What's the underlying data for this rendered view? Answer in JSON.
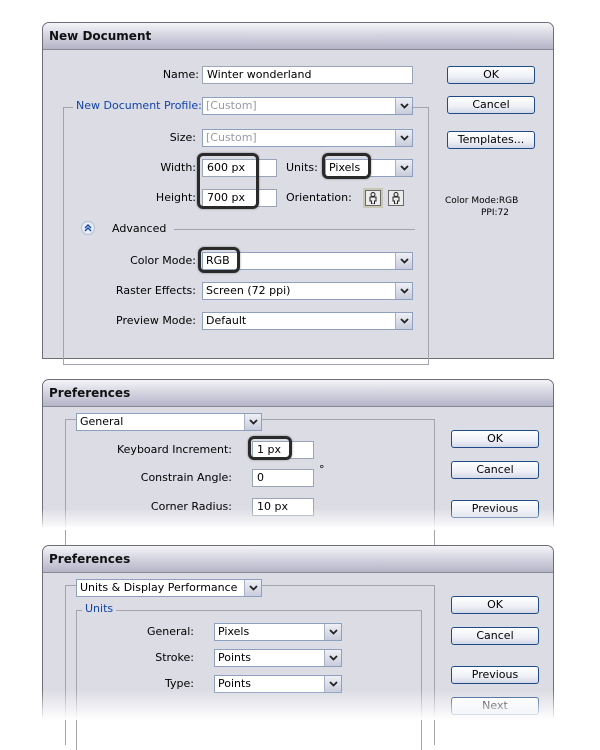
{
  "new_document": {
    "title": "New Document",
    "name_label": "Name:",
    "name_value": "Winter wonderland",
    "profile_label": "New Document Profile:",
    "profile_value": "[Custom]",
    "size_label": "Size:",
    "size_value": "[Custom]",
    "width_label": "Width:",
    "width_value": "600 px",
    "height_label": "Height:",
    "height_value": "700 px",
    "units_label": "Units:",
    "units_value": "Pixels",
    "orientation_label": "Orientation:",
    "advanced_label": "Advanced",
    "color_mode_label": "Color Mode:",
    "color_mode_value": "RGB",
    "raster_label": "Raster Effects:",
    "raster_value": "Screen (72 ppi)",
    "preview_label": "Preview Mode:",
    "preview_value": "Default",
    "buttons": {
      "ok": "OK",
      "cancel": "Cancel",
      "templates": "Templates..."
    },
    "info": {
      "color_mode": "Color Mode:RGB",
      "ppi": "PPI:72"
    }
  },
  "preferences_general": {
    "title": "Preferences",
    "section_value": "General",
    "keyboard_increment_label": "Keyboard Increment:",
    "keyboard_increment_value": "1 px",
    "constrain_angle_label": "Constrain Angle:",
    "constrain_angle_value": "0",
    "degree_symbol": "°",
    "corner_radius_label": "Corner Radius:",
    "corner_radius_value": "10 px",
    "buttons": {
      "ok": "OK",
      "cancel": "Cancel",
      "previous": "Previous"
    }
  },
  "preferences_units": {
    "title": "Preferences",
    "section_value": "Units & Display Performance",
    "units_group_label": "Units",
    "general_label": "General:",
    "general_value": "Pixels",
    "stroke_label": "Stroke:",
    "stroke_value": "Points",
    "type_label": "Type:",
    "type_value": "Points",
    "buttons": {
      "ok": "OK",
      "cancel": "Cancel",
      "previous": "Previous",
      "next": "Next"
    }
  },
  "colors": {
    "accent_blue": "#1144aa",
    "button_border": "#1f4c86",
    "dialog_bg": "#dcdce4"
  }
}
